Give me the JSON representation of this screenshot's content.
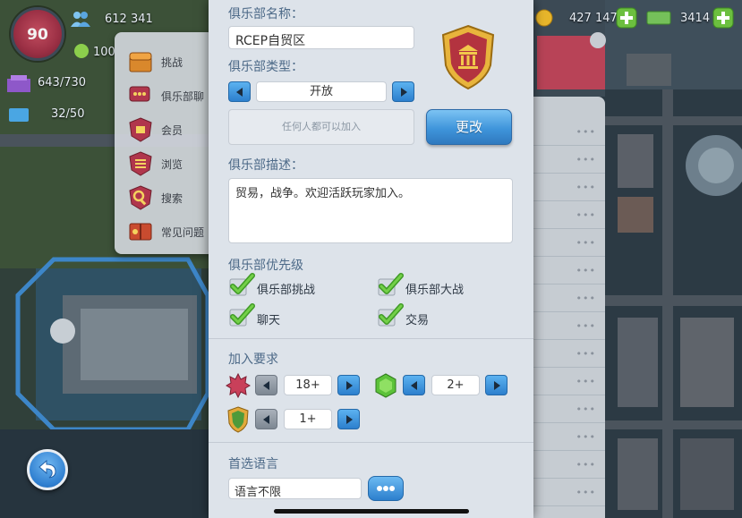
{
  "hud": {
    "level": "90",
    "population": "612 341",
    "small_count": "100",
    "storage": "643/730",
    "capacity": "32/50",
    "simoleons": "427 147",
    "simcash": "3414"
  },
  "side_menu": {
    "items": [
      {
        "label": "挑战",
        "icon": "chest-icon"
      },
      {
        "label": "俱乐部聊",
        "icon": "chat-icon"
      },
      {
        "label": "会员",
        "icon": "members-icon"
      },
      {
        "label": "浏览",
        "icon": "browse-icon"
      },
      {
        "label": "搜索",
        "icon": "search-icon"
      },
      {
        "label": "常见问题",
        "icon": "faq-book-icon"
      }
    ]
  },
  "right_list": {
    "more_symbol": "•••"
  },
  "club": {
    "name_label": "俱乐部名称：",
    "name_value": "RCEP自贸区",
    "type_label": "俱乐部类型：",
    "type_value": "开放",
    "type_hint": "任何人都可以加入",
    "update_button": "更改",
    "desc_label": "俱乐部描述：",
    "desc_value": "贸易，战争。欢迎活跃玩家加入。",
    "priority_label": "俱乐部优先级",
    "priorities": [
      {
        "label": "俱乐部挑战",
        "checked": true
      },
      {
        "label": "俱乐部大战",
        "checked": true
      },
      {
        "label": "聊天",
        "checked": true
      },
      {
        "label": "交易",
        "checked": true
      }
    ],
    "requirements_label": "加入要求",
    "requirements": {
      "level": "18+",
      "tier": "2+",
      "shield": "1+"
    },
    "language_label": "首选语言",
    "language_value": "语言不限"
  },
  "colors": {
    "accent_blue": "#3f95db",
    "section_title": "#4d6a88",
    "check_green": "#5cc23a",
    "level_red": "#9a2f44"
  }
}
